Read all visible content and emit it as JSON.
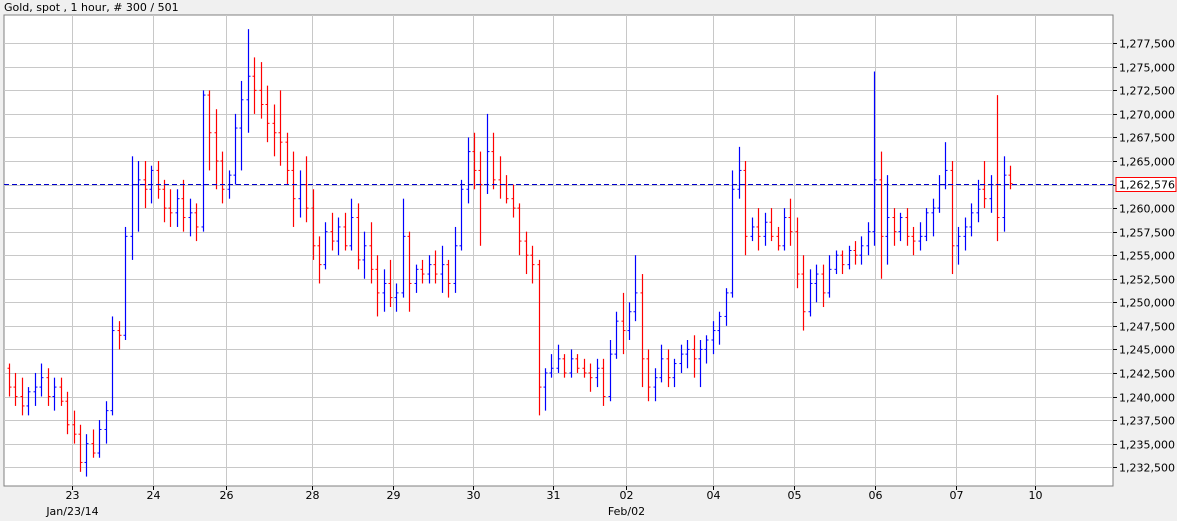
{
  "header": {
    "title": "Gold, spot , 1 hour, # 300 / 501"
  },
  "colors": {
    "up": "#0000ff",
    "down": "#ff0000",
    "neutral": "#000000",
    "last_line": "#0000cc",
    "grid": "#c8c8c8",
    "background": "#ffffff"
  },
  "chart_data": {
    "type": "ohlc",
    "instrument": "Gold, spot",
    "interval": "1 hour",
    "ylim": [
      1230.5,
      1280.5
    ],
    "grid": true,
    "y_ticks": [
      1232.5,
      1235,
      1237.5,
      1240,
      1242.5,
      1245,
      1247.5,
      1250,
      1252.5,
      1255,
      1257.5,
      1260,
      1262.5,
      1265,
      1267.5,
      1270,
      1272.5,
      1275,
      1277.5
    ],
    "y_tick_labels": [
      "1,232,500",
      "1,235,000",
      "1,237,500",
      "1,240,000",
      "1,242,500",
      "1,245,000",
      "1,247,500",
      "1,250,000",
      "1,252,500",
      "1,255,000",
      "1,257,500",
      "1,260,000",
      "1,262,500",
      "1,265,000",
      "1,267,500",
      "1,270,000",
      "1,272,500",
      "1,275,000",
      "1,277,500"
    ],
    "x_ticks": [
      {
        "label": "23",
        "sub": "Jan/23/14",
        "pos": 0.061
      },
      {
        "label": "24",
        "sub": "",
        "pos": 0.134
      },
      {
        "label": "26",
        "sub": "",
        "pos": 0.2
      },
      {
        "label": "28",
        "sub": "",
        "pos": 0.278
      },
      {
        "label": "29",
        "sub": "",
        "pos": 0.351
      },
      {
        "label": "30",
        "sub": "",
        "pos": 0.423
      },
      {
        "label": "31",
        "sub": "",
        "pos": 0.495
      },
      {
        "label": "02",
        "sub": "Feb/02",
        "pos": 0.561
      },
      {
        "label": "04",
        "sub": "",
        "pos": 0.639
      },
      {
        "label": "05",
        "sub": "",
        "pos": 0.712
      },
      {
        "label": "06",
        "sub": "",
        "pos": 0.785
      },
      {
        "label": "07",
        "sub": "",
        "pos": 0.858
      },
      {
        "label": "10",
        "sub": "",
        "pos": 0.93
      }
    ],
    "last_price": 1262.576,
    "last_price_label": "1,262,576",
    "bars": [
      [
        1243,
        1243.5,
        1240,
        1241
      ],
      [
        1241,
        1242.5,
        1239,
        1240
      ],
      [
        1240,
        1242,
        1238,
        1239
      ],
      [
        1239,
        1241,
        1238,
        1240.5
      ],
      [
        1240.5,
        1242.5,
        1239,
        1241
      ],
      [
        1241,
        1243.5,
        1240,
        1242
      ],
      [
        1242,
        1243,
        1239,
        1240
      ],
      [
        1240,
        1242,
        1238.5,
        1241
      ],
      [
        1241,
        1242,
        1239,
        1239.5
      ],
      [
        1239.5,
        1240.5,
        1236,
        1237
      ],
      [
        1237,
        1238.5,
        1235,
        1236
      ],
      [
        1236,
        1237,
        1232,
        1233
      ],
      [
        1233,
        1236,
        1231.5,
        1235
      ],
      [
        1235,
        1236.5,
        1233.5,
        1234
      ],
      [
        1234,
        1237.5,
        1233.5,
        1236.5
      ],
      [
        1236.5,
        1239.5,
        1235,
        1238.5
      ],
      [
        1238.5,
        1248.5,
        1238,
        1247
      ],
      [
        1247,
        1248,
        1245,
        1246.5
      ],
      [
        1246.5,
        1258,
        1246,
        1257
      ],
      [
        1257,
        1265.5,
        1254.5,
        1262.5
      ],
      [
        1262.5,
        1265,
        1257.5,
        1263
      ],
      [
        1263,
        1265,
        1260,
        1262
      ],
      [
        1262,
        1264.5,
        1260.5,
        1264
      ],
      [
        1264,
        1265,
        1261,
        1262
      ],
      [
        1262,
        1263,
        1258.5,
        1260
      ],
      [
        1260,
        1262,
        1258,
        1259.5
      ],
      [
        1259.5,
        1262,
        1258,
        1261
      ],
      [
        1261,
        1263,
        1257.5,
        1259
      ],
      [
        1259,
        1261,
        1257,
        1259.5
      ],
      [
        1259.5,
        1260.5,
        1256.5,
        1258
      ],
      [
        1258,
        1272.5,
        1257.5,
        1272
      ],
      [
        1272,
        1272.5,
        1264,
        1268
      ],
      [
        1268,
        1270.5,
        1262,
        1265
      ],
      [
        1265,
        1266,
        1260.5,
        1262
      ],
      [
        1262,
        1264,
        1261,
        1263.5
      ],
      [
        1263.5,
        1270,
        1262.5,
        1268.5
      ],
      [
        1268.5,
        1273.5,
        1264,
        1271.5
      ],
      [
        1271.5,
        1279,
        1268,
        1274
      ],
      [
        1274,
        1276,
        1270,
        1272.5
      ],
      [
        1272.5,
        1275.5,
        1269.5,
        1271
      ],
      [
        1271,
        1273,
        1267,
        1269
      ],
      [
        1269,
        1271,
        1265.5,
        1268
      ],
      [
        1268,
        1272.5,
        1264.5,
        1267
      ],
      [
        1267,
        1268,
        1262.5,
        1264
      ],
      [
        1264,
        1266,
        1258,
        1261
      ],
      [
        1261,
        1264,
        1259,
        1262.5
      ],
      [
        1262.5,
        1265.5,
        1258.5,
        1260
      ],
      [
        1260,
        1262,
        1254.5,
        1256
      ],
      [
        1256,
        1257,
        1252,
        1254
      ],
      [
        1254,
        1258.5,
        1253.5,
        1257.5
      ],
      [
        1257.5,
        1259.5,
        1255.5,
        1256.5
      ],
      [
        1256.5,
        1259,
        1255,
        1258
      ],
      [
        1258,
        1259.5,
        1255.5,
        1256
      ],
      [
        1256,
        1261,
        1255.5,
        1259
      ],
      [
        1259,
        1260.5,
        1253.5,
        1254.5
      ],
      [
        1254.5,
        1257.5,
        1252.5,
        1256
      ],
      [
        1256,
        1258.5,
        1252,
        1253.5
      ],
      [
        1253.5,
        1255,
        1248.5,
        1251
      ],
      [
        1251,
        1253.5,
        1249,
        1252
      ],
      [
        1252,
        1254.5,
        1249.5,
        1250.5
      ],
      [
        1250.5,
        1252,
        1249,
        1251
      ],
      [
        1251,
        1261,
        1250.5,
        1257
      ],
      [
        1257,
        1257.5,
        1249,
        1252
      ],
      [
        1252,
        1254,
        1251,
        1253.5
      ],
      [
        1253.5,
        1254.5,
        1252,
        1253
      ],
      [
        1253,
        1255,
        1252,
        1254
      ],
      [
        1254,
        1255.5,
        1252,
        1253
      ],
      [
        1253,
        1256,
        1251,
        1254
      ],
      [
        1254,
        1254.5,
        1250.5,
        1252
      ],
      [
        1252,
        1258,
        1251,
        1256
      ],
      [
        1256,
        1263,
        1255.5,
        1262
      ],
      [
        1262,
        1267.5,
        1260.5,
        1266
      ],
      [
        1266,
        1268,
        1262,
        1264
      ],
      [
        1264,
        1266,
        1256,
        1262.5
      ],
      [
        1262.5,
        1270,
        1261.5,
        1266
      ],
      [
        1266,
        1268,
        1262,
        1263
      ],
      [
        1263,
        1265.5,
        1261,
        1262.5
      ],
      [
        1262.5,
        1263.5,
        1260.5,
        1261
      ],
      [
        1261,
        1262.5,
        1259,
        1260
      ],
      [
        1260,
        1260.5,
        1255,
        1256.5
      ],
      [
        1256.5,
        1257.5,
        1253,
        1255
      ],
      [
        1255,
        1256,
        1252,
        1254
      ],
      [
        1254,
        1254.5,
        1238,
        1241
      ],
      [
        1241,
        1243,
        1238.5,
        1242.5
      ],
      [
        1242.5,
        1244.5,
        1242,
        1243
      ],
      [
        1243,
        1245.5,
        1242.5,
        1244
      ],
      [
        1244,
        1244.5,
        1242,
        1242.5
      ],
      [
        1242.5,
        1245,
        1242,
        1244
      ],
      [
        1244,
        1244.5,
        1242.5,
        1243
      ],
      [
        1243,
        1244,
        1242,
        1242.5
      ],
      [
        1242.5,
        1243.5,
        1240.5,
        1242
      ],
      [
        1242,
        1244,
        1241,
        1243
      ],
      [
        1243,
        1244,
        1239,
        1240
      ],
      [
        1240,
        1246,
        1239.5,
        1244.5
      ],
      [
        1244.5,
        1249,
        1244,
        1248
      ],
      [
        1248,
        1251,
        1244.5,
        1247
      ],
      [
        1247,
        1250,
        1246,
        1249
      ],
      [
        1249,
        1255,
        1248,
        1251
      ],
      [
        1251,
        1253,
        1241,
        1244
      ],
      [
        1244,
        1245,
        1239.5,
        1241
      ],
      [
        1241,
        1243,
        1239.5,
        1242
      ],
      [
        1242,
        1245.5,
        1241.5,
        1244
      ],
      [
        1244,
        1245,
        1241,
        1242
      ],
      [
        1242,
        1244,
        1241,
        1243.5
      ],
      [
        1243.5,
        1245.5,
        1242.5,
        1244.5
      ],
      [
        1244.5,
        1246,
        1243,
        1245
      ],
      [
        1245,
        1246.5,
        1242,
        1244
      ],
      [
        1244,
        1246,
        1241,
        1245
      ],
      [
        1245,
        1246.5,
        1243.5,
        1246
      ],
      [
        1246,
        1248,
        1244.5,
        1247
      ],
      [
        1247,
        1249,
        1245.5,
        1248.5
      ],
      [
        1248.5,
        1251.5,
        1247.5,
        1251
      ],
      [
        1251,
        1264,
        1250.5,
        1262
      ],
      [
        1262,
        1266.5,
        1261,
        1264
      ],
      [
        1264,
        1265,
        1255,
        1257
      ],
      [
        1257,
        1259,
        1256.5,
        1258
      ],
      [
        1258,
        1260,
        1255.5,
        1257
      ],
      [
        1257,
        1259.5,
        1256,
        1258.5
      ],
      [
        1258.5,
        1260,
        1256.5,
        1257
      ],
      [
        1257,
        1258,
        1255.5,
        1256
      ],
      [
        1256,
        1260,
        1255.5,
        1259
      ],
      [
        1259,
        1261,
        1256,
        1257.5
      ],
      [
        1257.5,
        1259,
        1251.5,
        1253
      ],
      [
        1253,
        1255,
        1247,
        1249
      ],
      [
        1249,
        1253.5,
        1248.5,
        1252
      ],
      [
        1252,
        1254,
        1250,
        1253
      ],
      [
        1253,
        1254,
        1249.5,
        1251
      ],
      [
        1251,
        1255,
        1250.5,
        1253.5
      ],
      [
        1253.5,
        1255.5,
        1253,
        1255
      ],
      [
        1255,
        1255.5,
        1253,
        1254
      ],
      [
        1254,
        1256,
        1253.5,
        1255.5
      ],
      [
        1255.5,
        1256.5,
        1254,
        1255
      ],
      [
        1255,
        1257,
        1254,
        1256
      ],
      [
        1256,
        1258.5,
        1255,
        1257.5
      ],
      [
        1257.5,
        1274.5,
        1256,
        1263
      ],
      [
        1263,
        1266,
        1252.5,
        1257
      ],
      [
        1257,
        1263.5,
        1254,
        1259
      ],
      [
        1259,
        1260,
        1256,
        1257.5
      ],
      [
        1257.5,
        1259.5,
        1256.5,
        1259
      ],
      [
        1259,
        1260,
        1256,
        1257
      ],
      [
        1257,
        1258,
        1255,
        1256.5
      ],
      [
        1256.5,
        1258.5,
        1255.5,
        1257
      ],
      [
        1257,
        1260,
        1256.5,
        1259.5
      ],
      [
        1259.5,
        1261,
        1257,
        1260
      ],
      [
        1260,
        1263.5,
        1259.5,
        1262.5
      ],
      [
        1262.5,
        1267,
        1262,
        1264
      ],
      [
        1264,
        1265,
        1253,
        1256
      ],
      [
        1256,
        1258,
        1254,
        1257
      ],
      [
        1257,
        1259,
        1255.5,
        1258
      ],
      [
        1258,
        1260.5,
        1257,
        1259.5
      ],
      [
        1259.5,
        1263,
        1258.5,
        1262
      ],
      [
        1262,
        1265,
        1260,
        1261
      ],
      [
        1261,
        1263.5,
        1259.5,
        1262.5
      ],
      [
        1262.5,
        1272,
        1256.5,
        1259
      ],
      [
        1259,
        1265.5,
        1257.5,
        1263.5
      ],
      [
        1263.5,
        1264.5,
        1262,
        1262.6
      ]
    ]
  }
}
